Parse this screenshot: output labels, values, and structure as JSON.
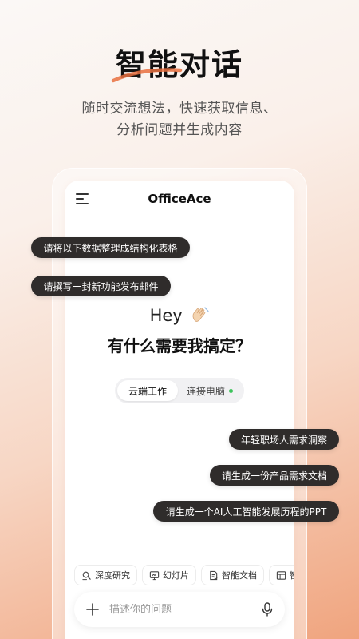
{
  "promo": {
    "headline": "智能对话",
    "subtitle_line1": "随时交流想法，快速获取信息、",
    "subtitle_line2": "分析问题并生成内容"
  },
  "app": {
    "title": "OfficeAce",
    "hey": "Hey",
    "greeting": "有什么需要我搞定？",
    "mode_toggle": {
      "active": "云端工作",
      "inactive": "连接电脑",
      "status_color": "#3cc35a"
    },
    "tools": [
      {
        "label": "深度研究",
        "icon": "research-icon"
      },
      {
        "label": "幻灯片",
        "icon": "slides-icon"
      },
      {
        "label": "智能文档",
        "icon": "document-icon"
      },
      {
        "label": "智",
        "icon": "table-icon"
      }
    ],
    "input": {
      "placeholder": "描述你的问题"
    }
  },
  "suggestions_left": [
    "请将以下数据整理成结构化表格",
    "请撰写一封新功能发布邮件"
  ],
  "suggestions_right": [
    "年轻职场人需求洞察",
    "请生成一份产品需求文档",
    "请生成一个AI人工智能发展历程的PPT"
  ],
  "colors": {
    "accent": "#e8703f",
    "bubble": "#2f2c2b"
  }
}
